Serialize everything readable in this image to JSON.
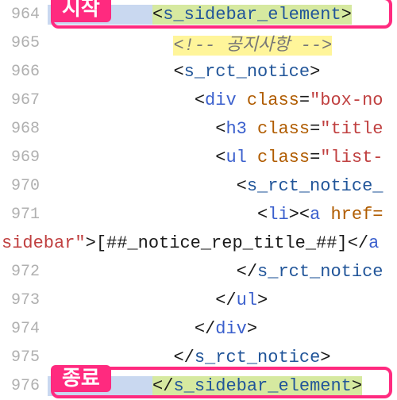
{
  "callouts": {
    "start": "시작",
    "end": "종료"
  },
  "lines": [
    {
      "num": "964",
      "indent": "          ",
      "tokens": [
        {
          "t": "<",
          "c": "br hl-green"
        },
        {
          "t": "s_sidebar_element",
          "c": "s-tag hl-green"
        },
        {
          "t": ">",
          "c": "br hl-green"
        }
      ],
      "selected": true
    },
    {
      "num": "965",
      "indent": "            ",
      "tokens": [
        {
          "t": "<!-- 공지사항 -->",
          "c": "cmt hl-yellow"
        }
      ]
    },
    {
      "num": "966",
      "indent": "            ",
      "tokens": [
        {
          "t": "<",
          "c": "br"
        },
        {
          "t": "s_rct_notice",
          "c": "s-tag"
        },
        {
          "t": ">",
          "c": "br"
        }
      ]
    },
    {
      "num": "967",
      "indent": "              ",
      "tokens": [
        {
          "t": "<",
          "c": "br"
        },
        {
          "t": "div",
          "c": "tag"
        },
        {
          "t": " ",
          "c": ""
        },
        {
          "t": "class",
          "c": "attr"
        },
        {
          "t": "=",
          "c": "eq"
        },
        {
          "t": "\"box-no",
          "c": "str"
        }
      ]
    },
    {
      "num": "968",
      "indent": "                ",
      "tokens": [
        {
          "t": "<",
          "c": "br"
        },
        {
          "t": "h3",
          "c": "tag"
        },
        {
          "t": " ",
          "c": ""
        },
        {
          "t": "class",
          "c": "attr"
        },
        {
          "t": "=",
          "c": "eq"
        },
        {
          "t": "\"title",
          "c": "str"
        }
      ]
    },
    {
      "num": "969",
      "indent": "                ",
      "tokens": [
        {
          "t": "<",
          "c": "br"
        },
        {
          "t": "ul",
          "c": "tag"
        },
        {
          "t": " ",
          "c": ""
        },
        {
          "t": "class",
          "c": "attr"
        },
        {
          "t": "=",
          "c": "eq"
        },
        {
          "t": "\"list-",
          "c": "str"
        }
      ]
    },
    {
      "num": "970",
      "indent": "                  ",
      "tokens": [
        {
          "t": "<",
          "c": "br"
        },
        {
          "t": "s_rct_notice_",
          "c": "s-tag"
        }
      ]
    },
    {
      "num": "971",
      "indent": "                    ",
      "tokens": [
        {
          "t": "<",
          "c": "br"
        },
        {
          "t": "li",
          "c": "tag"
        },
        {
          "t": ">",
          "c": "br"
        },
        {
          "t": "<",
          "c": "br"
        },
        {
          "t": "a",
          "c": "tag"
        },
        {
          "t": " ",
          "c": ""
        },
        {
          "t": "href=",
          "c": "attr"
        }
      ]
    },
    {
      "num": "",
      "indent": "",
      "wrap": true,
      "tokens": [
        {
          "t": "sidebar\"",
          "c": "str"
        },
        {
          "t": ">",
          "c": "br"
        },
        {
          "t": "[##_notice_rep_title_##]",
          "c": "br"
        },
        {
          "t": "</",
          "c": "br"
        },
        {
          "t": "a",
          "c": "tag"
        }
      ]
    },
    {
      "num": "972",
      "indent": "                  ",
      "tokens": [
        {
          "t": "</",
          "c": "br"
        },
        {
          "t": "s_rct_notice",
          "c": "s-tag"
        }
      ]
    },
    {
      "num": "973",
      "indent": "                ",
      "tokens": [
        {
          "t": "</",
          "c": "br"
        },
        {
          "t": "ul",
          "c": "tag"
        },
        {
          "t": ">",
          "c": "br"
        }
      ]
    },
    {
      "num": "974",
      "indent": "              ",
      "tokens": [
        {
          "t": "</",
          "c": "br"
        },
        {
          "t": "div",
          "c": "tag"
        },
        {
          "t": ">",
          "c": "br"
        }
      ]
    },
    {
      "num": "975",
      "indent": "            ",
      "tokens": [
        {
          "t": "</",
          "c": "br"
        },
        {
          "t": "s_rct_notice",
          "c": "s-tag"
        },
        {
          "t": ">",
          "c": "br"
        }
      ]
    },
    {
      "num": "976",
      "indent": "          ",
      "tokens": [
        {
          "t": "</",
          "c": "br hl-green"
        },
        {
          "t": "s_sidebar_element",
          "c": "s-tag hl-green"
        },
        {
          "t": ">",
          "c": "br hl-green"
        }
      ],
      "selected": true
    }
  ]
}
